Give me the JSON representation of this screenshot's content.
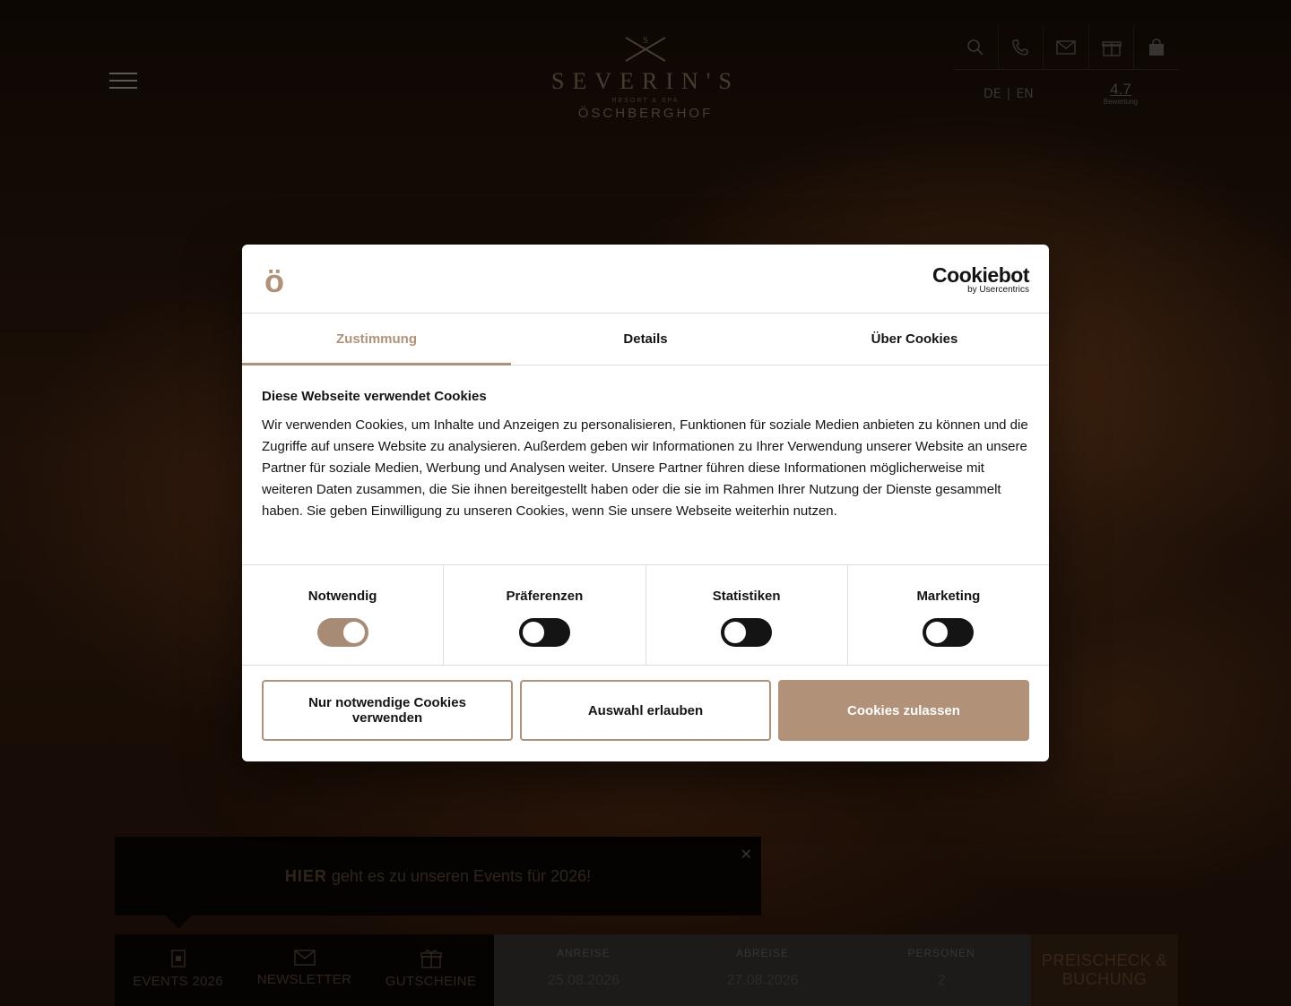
{
  "header": {
    "logo": {
      "word": "SEVERIN'S",
      "sub": "RESORT & SPA",
      "sub2": "ÖSCHBERGHOF"
    },
    "icons": [
      "search-icon",
      "phone-icon",
      "mail-icon",
      "gift-icon",
      "shopping-bag-icon"
    ],
    "lang": {
      "de": "DE",
      "separator": "|",
      "en": "EN"
    },
    "rating": {
      "value": "4.7",
      "label": "Bewertung"
    }
  },
  "event_banner": {
    "highlight": "HIER",
    "text": "geht es zu unseren Events für 2026!"
  },
  "bottom_bar": {
    "links": [
      {
        "label": "EVENTS 2026",
        "icon": "calendar-icon"
      },
      {
        "label": "NEWSLETTER",
        "icon": "mail-icon"
      },
      {
        "label": "GUTSCHEINE",
        "icon": "gift-icon"
      }
    ],
    "booking": {
      "arrival_label": "ANREISE",
      "arrival_value": "25.08.2026",
      "departure_label": "ABREISE",
      "departure_value": "27.08.2026",
      "persons_label": "PERSONEN",
      "persons_value": "2"
    },
    "cta": "PREISCHECK & BUCHUNG"
  },
  "cookie_dialog": {
    "brand_glyph": "ö",
    "provider_name": "Cookiebot",
    "provider_sub": "by Usercentrics",
    "tabs": [
      "Zustimmung",
      "Details",
      "Über Cookies"
    ],
    "active_tab": "Zustimmung",
    "title": "Diese Webseite verwendet Cookies",
    "text": "Wir verwenden Cookies, um Inhalte und Anzeigen zu personalisieren, Funktionen für soziale Medien anbieten zu können und die Zugriffe auf unsere Website zu analysieren. Außerdem geben wir Informationen zu Ihrer Verwendung unserer Website an unsere Partner für soziale Medien, Werbung und Analysen weiter. Unsere Partner führen diese Informationen möglicherweise mit weiteren Daten zusammen, die Sie ihnen bereitgestellt haben oder die sie im Rahmen Ihrer Nutzung der Dienste gesammelt haben. Sie geben Einwilligung zu unseren Cookies, wenn Sie unsere Webseite weiterhin nutzen.",
    "categories": [
      {
        "name": "Notwendig",
        "enabled": true
      },
      {
        "name": "Präferenzen",
        "enabled": false
      },
      {
        "name": "Statistiken",
        "enabled": false
      },
      {
        "name": "Marketing",
        "enabled": false
      }
    ],
    "buttons": {
      "necessary_only": "Nur notwendige Cookies verwenden",
      "allow_selection": "Auswahl erlauben",
      "allow_all": "Cookies zulassen"
    },
    "colors": {
      "accent": "#b19278",
      "text": "#141414"
    }
  }
}
